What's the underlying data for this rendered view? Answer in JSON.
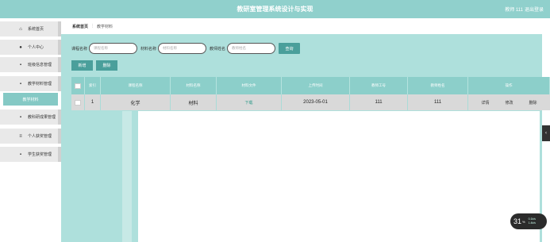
{
  "header": {
    "title": "教研室管理系统设计与实现",
    "user": "教师 111",
    "logout": "退出登录"
  },
  "sidebar": {
    "items": [
      {
        "label": "系统首页",
        "icon": "home-icon",
        "glyph": "⌂"
      },
      {
        "label": "个人中心",
        "icon": "user-icon",
        "glyph": "●"
      },
      {
        "label": "班级信息管理",
        "icon": "grid-icon",
        "glyph": "▪"
      },
      {
        "label": "教学材料管理",
        "icon": "grid-icon",
        "glyph": "▪"
      },
      {
        "label": "教学材料",
        "icon": "",
        "glyph": ""
      },
      {
        "label": "教科研成果管理",
        "icon": "grid-icon",
        "glyph": "▪"
      },
      {
        "label": "个人获奖管理",
        "icon": "list-icon",
        "glyph": "≡"
      },
      {
        "label": "学生获奖管理",
        "icon": "grid-icon",
        "glyph": "▪"
      }
    ]
  },
  "breadcrumb": {
    "home": "系统首页",
    "separator": "⋮",
    "current": "教学材料"
  },
  "search": {
    "course_label": "课程名称",
    "course_placeholder": "课程名称",
    "material_label": "材料名称",
    "material_placeholder": "材料名称",
    "teacher_label": "教师姓名",
    "teacher_placeholder": "教师姓名",
    "button": "查询"
  },
  "actions": {
    "add": "新增",
    "delete": "删除"
  },
  "table": {
    "headers": [
      "索引",
      "课程名称",
      "材料名称",
      "材料文件",
      "上传时间",
      "教师工号",
      "教师姓名",
      "操作"
    ],
    "rows": [
      {
        "index": "1",
        "course": "化学",
        "material": "材料",
        "file": "下载",
        "date": "2023-05-01",
        "teacher_id": "111",
        "teacher_name": "111",
        "ops": [
          "详情",
          "修改",
          "删除"
        ]
      }
    ]
  },
  "widget": {
    "value": "31",
    "unit": "%",
    "up": "0.1k/s",
    "down": "1.4k/s"
  },
  "colors": {
    "header": "#90d0cc",
    "accent": "#4a9f9b",
    "content_bg": "#aee0dc",
    "row": "#d9d9d9"
  }
}
